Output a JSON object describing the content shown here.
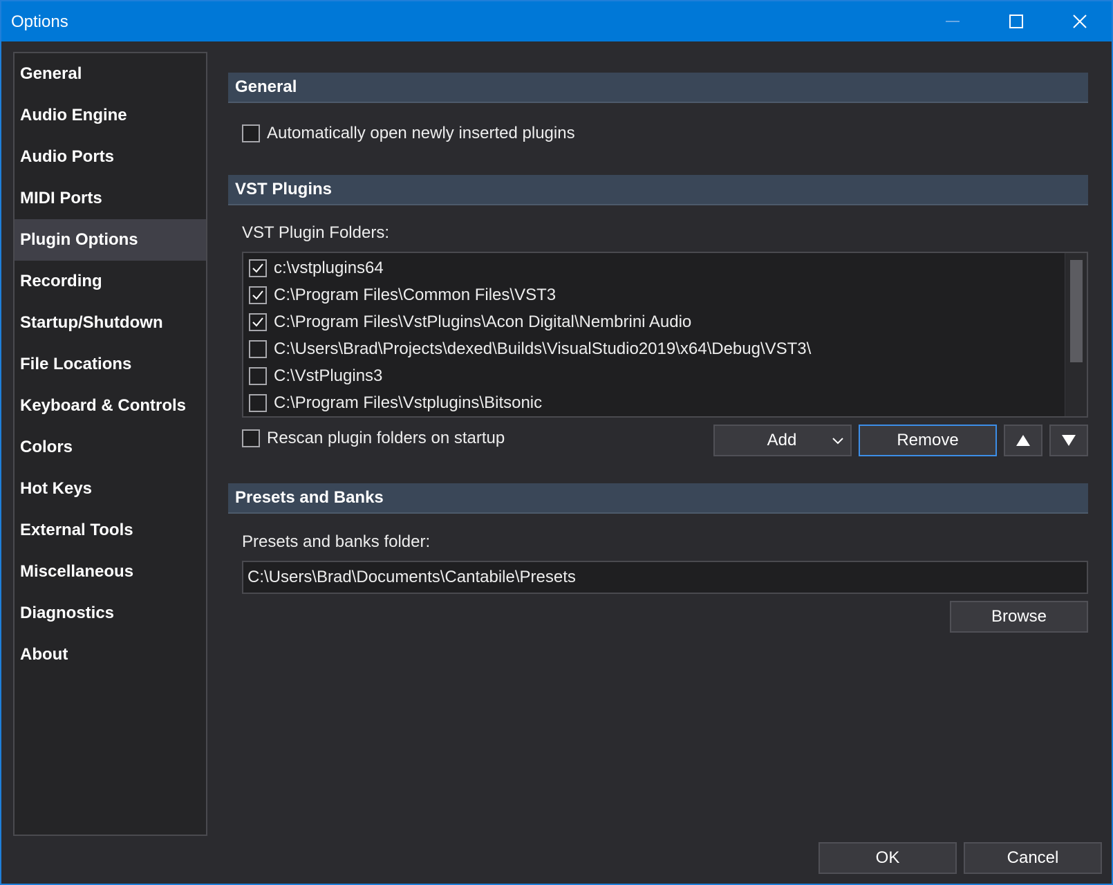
{
  "window": {
    "title": "Options"
  },
  "sidebar": {
    "items": [
      {
        "label": "General"
      },
      {
        "label": "Audio Engine"
      },
      {
        "label": "Audio Ports"
      },
      {
        "label": "MIDI Ports"
      },
      {
        "label": "Plugin Options",
        "selected": true
      },
      {
        "label": "Recording"
      },
      {
        "label": "Startup/Shutdown"
      },
      {
        "label": "File Locations"
      },
      {
        "label": "Keyboard & Controls"
      },
      {
        "label": "Colors"
      },
      {
        "label": "Hot Keys"
      },
      {
        "label": "External Tools"
      },
      {
        "label": "Miscellaneous"
      },
      {
        "label": "Diagnostics"
      },
      {
        "label": "About"
      }
    ]
  },
  "general_section": {
    "header": "General",
    "auto_open_label": "Automatically open newly inserted plugins",
    "auto_open_checked": false
  },
  "vst_section": {
    "header": "VST Plugins",
    "folders_label": "VST Plugin Folders:",
    "folders": [
      {
        "path": "c:\\vstplugins64",
        "checked": true
      },
      {
        "path": "C:\\Program Files\\Common Files\\VST3",
        "checked": true
      },
      {
        "path": "C:\\Program Files\\VstPlugins\\Acon Digital\\Nembrini Audio",
        "checked": true
      },
      {
        "path": "C:\\Users\\Brad\\Projects\\dexed\\Builds\\VisualStudio2019\\x64\\Debug\\VST3\\",
        "checked": false
      },
      {
        "path": "C:\\VstPlugins3",
        "checked": false
      },
      {
        "path": "C:\\Program Files\\Vstplugins\\Bitsonic",
        "checked": false
      }
    ],
    "rescan_label": "Rescan plugin folders on startup",
    "rescan_checked": false,
    "add_label": "Add",
    "remove_label": "Remove"
  },
  "presets_section": {
    "header": "Presets and Banks",
    "folder_label": "Presets and banks folder:",
    "folder_value": "C:\\Users\\Brad\\Documents\\Cantabile\\Presets",
    "browse_label": "Browse"
  },
  "footer": {
    "ok_label": "OK",
    "cancel_label": "Cancel"
  },
  "colors": {
    "titlebar": "#0078d7",
    "background": "#2b2b2f",
    "section_header": "#3a4758",
    "focus_border": "#3c8ee8"
  }
}
